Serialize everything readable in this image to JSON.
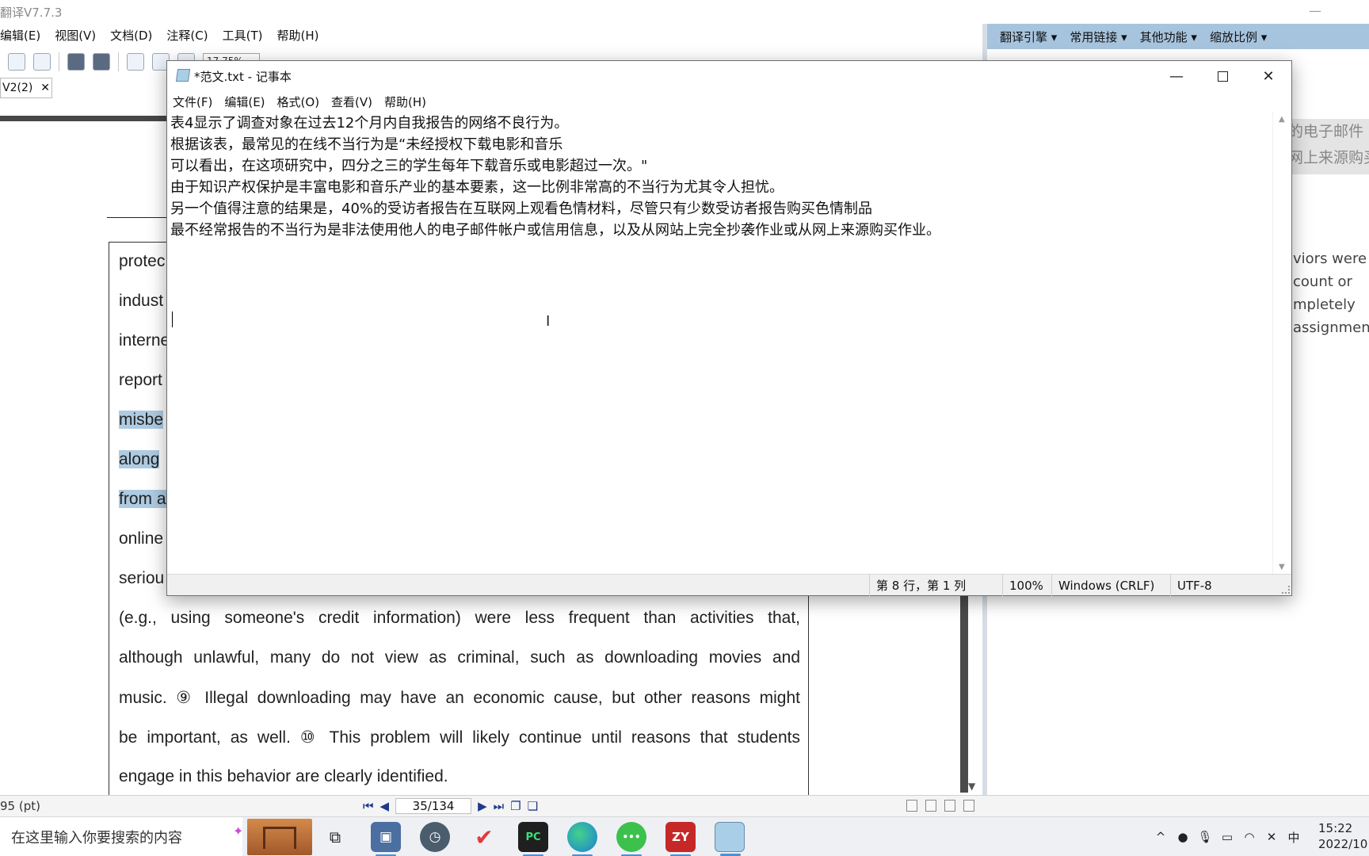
{
  "bg_app": {
    "title": "翻译V7.7.3",
    "menu": [
      "编辑(E)",
      "视图(V)",
      "文档(D)",
      "注释(C)",
      "工具(T)",
      "帮助(H)"
    ],
    "zoom_box": "17.75%",
    "tab": {
      "label": "V2(2)",
      "close": "✕"
    },
    "document_lines": [
      "protec",
      "indust",
      "interne",
      "report",
      "misbe",
      "along",
      "from a",
      "online",
      "seriou",
      "(e.g., using someone's credit information) were less frequent than activities that,",
      "although unlawful, many do not view as criminal, such as downloading movies and",
      "music. ⑨ Illegal downloading may have an economic cause, but other reasons might",
      "be important, as well. ⑩ This problem will likely continue until reasons that students",
      "engage in this behavior are clearly identified."
    ],
    "highlighted_lines": [
      4,
      5,
      6
    ],
    "right_panel": {
      "toolbar": [
        "翻译引擎 ▾",
        "常用链接 ▾",
        "其他功能 ▾",
        "缩放比例 ▾"
      ],
      "cn_lines": [
        "的电子邮件",
        "网上来源购买"
      ],
      "en_lines": [
        "viors were",
        "count   or",
        "mpletely",
        "assignmen"
      ]
    },
    "status": {
      "zoom_pt": "95 (pt)",
      "page": "35/134"
    }
  },
  "notepad": {
    "title": "*范文.txt - 记事本",
    "menu": [
      "文件(F)",
      "编辑(E)",
      "格式(O)",
      "查看(V)",
      "帮助(H)"
    ],
    "lines": [
      "表4显示了调查对象在过去12个月内自我报告的网络不良行为。",
      "根据该表，最常见的在线不当行为是“未经授权下载电影和音乐",
      "可以看出，在这项研究中，四分之三的学生每年下载音乐或电影超过一次。\"",
      "由于知识产权保护是丰富电影和音乐产业的基本要素，这一比例非常高的不当行为尤其令人担忧。",
      "另一个值得注意的结果是，40%的受访者报告在互联网上观看色情材料，尽管只有少数受访者报告购买色情制品",
      "最不经常报告的不当行为是非法使用他人的电子邮件帐户或信用信息，以及从网站上完全抄袭作业或从网上来源购买作业。"
    ],
    "status": {
      "position": "第 8 行，第 1 列",
      "zoom": "100%",
      "line_ending": "Windows (CRLF)",
      "encoding": "UTF-8"
    }
  },
  "taskbar": {
    "search_placeholder": "在这里输入你要搜索的内容",
    "apps": [
      "task-view",
      "photos",
      "clock",
      "vim",
      "pycharm",
      "edge",
      "wechat",
      "zy",
      "notepad"
    ],
    "app_labels": {
      "pycharm": "PC",
      "zy": "ZY",
      "wechat": "•••"
    },
    "tray_lang": "中",
    "time": "15:22",
    "date": "2022/10"
  },
  "colors": {
    "highlight": "#aecbe2",
    "panel_toolbar": "#a7c4de"
  }
}
